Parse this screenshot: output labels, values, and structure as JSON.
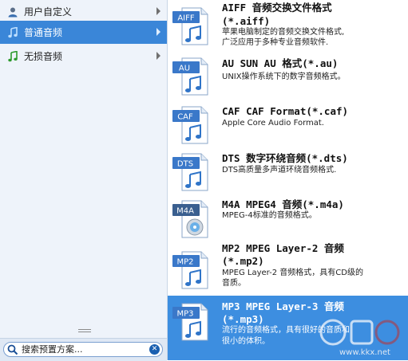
{
  "sidebar": {
    "items": [
      {
        "label": "用户自定义",
        "icon": "user-icon",
        "selected": false
      },
      {
        "label": "普通音频",
        "icon": "music-note-icon",
        "selected": true
      },
      {
        "label": "无损音频",
        "icon": "music-note-green-icon",
        "selected": false
      }
    ],
    "search_placeholder": "搜索预置方案..."
  },
  "formats": [
    {
      "badge": "AIFF",
      "title1": "AIFF 音频交换文件格式",
      "title2": "(*.aiff)",
      "desc1": "苹果电脑制定的音频交换文件格式,",
      "desc2": "广泛应用于多种专业音频软件."
    },
    {
      "badge": "AU",
      "title1": "AU SUN AU 格式(*.au)",
      "desc1": "UNIX操作系统下的数字音频格式。"
    },
    {
      "badge": "CAF",
      "title1": "CAF CAF Format(*.caf)",
      "desc1": "Apple Core Audio Format."
    },
    {
      "badge": "DTS",
      "title1": "DTS 数字环绕音频(*.dts)",
      "desc1": "DTS高质量多声道环绕音频格式."
    },
    {
      "badge": "M4A",
      "title1": "M4A MPEG4 音频(*.m4a)",
      "desc1": "MPEG-4标准的音频格式。"
    },
    {
      "badge": "MP2",
      "title1": "MP2 MPEG Layer-2 音频",
      "title2": "(*.mp2)",
      "desc1": "MPEG Layer-2 音频格式，具有CD级的",
      "desc2": "音质。"
    },
    {
      "badge": "MP3",
      "title1": "MP3 MPEG Layer-3 音频",
      "title2": "(*.mp3)",
      "desc1": "流行的音频格式，具有很好的音质和",
      "desc2": "很小的体积。",
      "selected": true
    }
  ],
  "watermark": "www.kkx.net",
  "colors": {
    "selection": "#3a86d8",
    "badge": "#3a78c9",
    "sidebar_bg": "#eef3fa"
  }
}
